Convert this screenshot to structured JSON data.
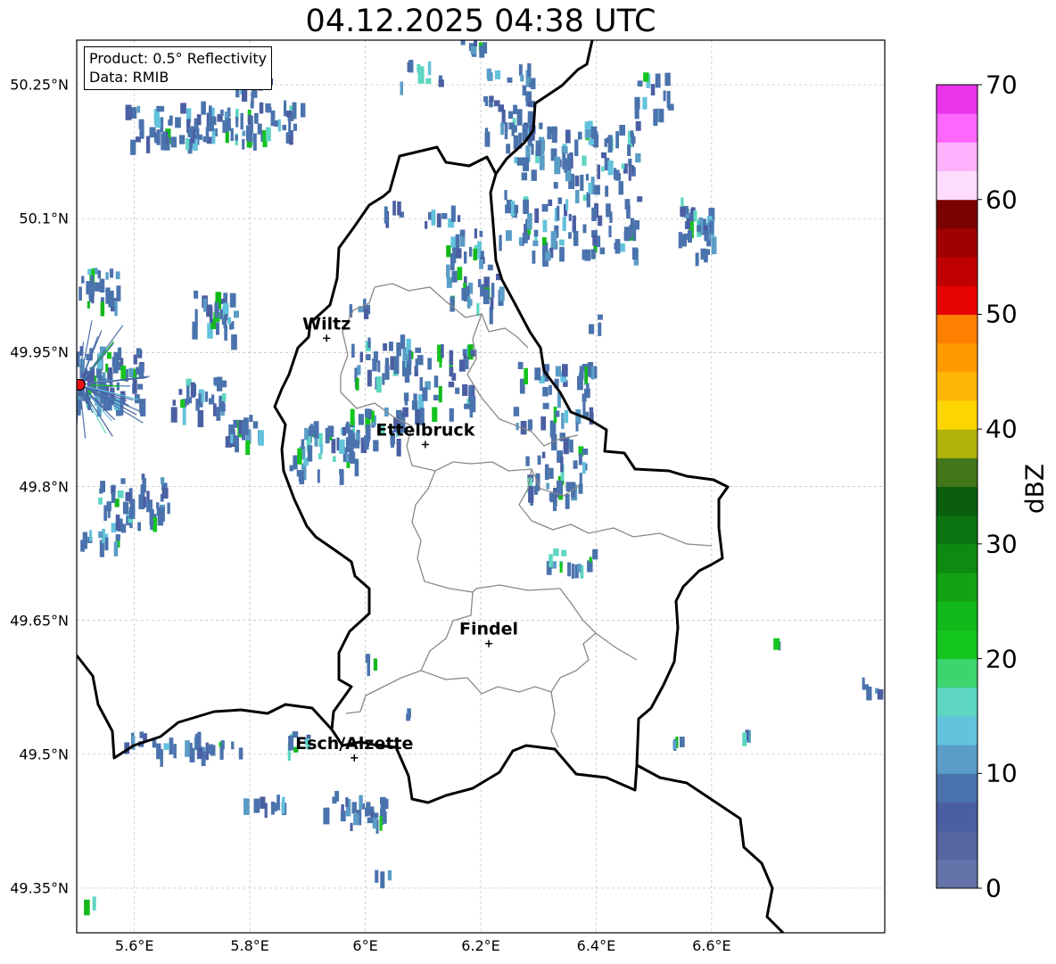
{
  "title": "04.12.2025 04:38 UTC",
  "info": {
    "product": "Product: 0.5° Reflectivity",
    "data": "Data: RMIB"
  },
  "map_extent": {
    "lon_min": 5.5,
    "lon_max": 6.9,
    "lat_min": 49.3,
    "lat_max": 50.3
  },
  "lat_ticks": [
    {
      "value": 50.25,
      "label": "50.25°N"
    },
    {
      "value": 50.1,
      "label": "50.1°N"
    },
    {
      "value": 49.95,
      "label": "49.95°N"
    },
    {
      "value": 49.8,
      "label": "49.8°N"
    },
    {
      "value": 49.65,
      "label": "49.65°N"
    },
    {
      "value": 49.5,
      "label": "49.5°N"
    },
    {
      "value": 49.35,
      "label": "49.35°N"
    }
  ],
  "lon_ticks": [
    {
      "value": 5.6,
      "label": "5.6°E"
    },
    {
      "value": 5.8,
      "label": "5.8°E"
    },
    {
      "value": 6.0,
      "label": "6°E"
    },
    {
      "value": 6.2,
      "label": "6.2°E"
    },
    {
      "value": 6.4,
      "label": "6.4°E"
    },
    {
      "value": 6.6,
      "label": "6.6°E"
    }
  ],
  "cities": [
    {
      "name": "Wiltz",
      "lon": 5.933,
      "lat": 49.966
    },
    {
      "name": "Ettelbruck",
      "lon": 6.104,
      "lat": 49.847
    },
    {
      "name": "Findel",
      "lon": 6.214,
      "lat": 49.624
    },
    {
      "name": "Esch/Alzette",
      "lon": 5.981,
      "lat": 49.496
    }
  ],
  "radar_site": {
    "lon": 5.505,
    "lat": 49.914
  },
  "colorbar": {
    "label": "dBZ",
    "min": 0,
    "max": 70,
    "step": 2.5,
    "ticks": [
      "0",
      "10",
      "20",
      "30",
      "40",
      "50",
      "60",
      "70"
    ],
    "colors": [
      "#6473a8",
      "#5566a0",
      "#4a5ea2",
      "#4a73ad",
      "#5a9dc6",
      "#63c2dc",
      "#5dd6c2",
      "#3dd46e",
      "#14c51e",
      "#12b81a",
      "#11a312",
      "#0e8a10",
      "#0b7410",
      "#0a5e0c",
      "#43761a",
      "#afb30a",
      "#fed501",
      "#fdb605",
      "#fe9a00",
      "#fe8000",
      "#e60200",
      "#c00000",
      "#9f0001",
      "#7b0000",
      "#fedcfe",
      "#feb2fe",
      "#fe66fe",
      "#ea33ea"
    ]
  }
}
